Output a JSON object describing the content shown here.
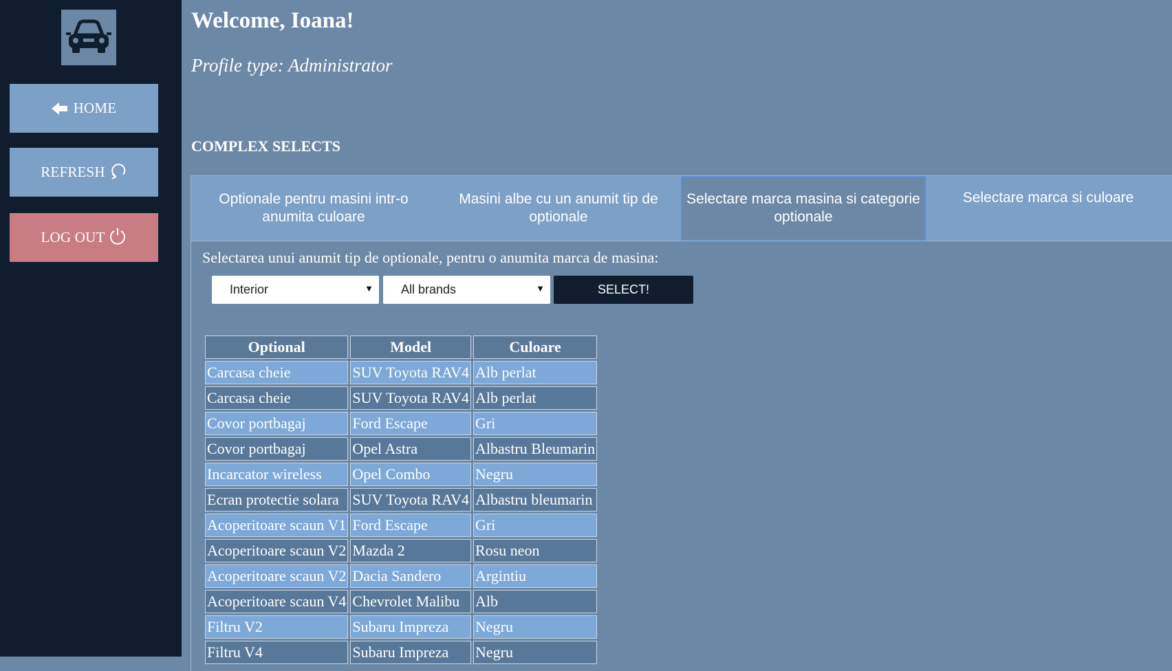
{
  "sidebar": {
    "logo_icon": "car-icon",
    "home_label": "HOME",
    "refresh_label": "REFRESH",
    "logout_label": "LOG OUT"
  },
  "header": {
    "welcome": "Welcome, Ioana!",
    "profile": "Profile type: Administrator"
  },
  "section_title": "COMPLEX SELECTS",
  "tabs": [
    {
      "label": "Optionale pentru masini intr-o anumita culoare",
      "active": false
    },
    {
      "label": "Masini albe cu un anumit tip de optionale",
      "active": false
    },
    {
      "label": "Selectare marca masina si categorie optionale",
      "active": true
    },
    {
      "label": "Selectare marca si culoare",
      "active": false
    }
  ],
  "query": {
    "label": "Selectarea unui anumit tip de optionale, pentru o anumita marca de masina:",
    "type_value": "Interior",
    "brand_value": "All brands",
    "button_label": "SELECT!"
  },
  "table": {
    "headers": [
      "Optional",
      "Model",
      "Culoare"
    ],
    "rows": [
      [
        "Carcasa cheie",
        "SUV Toyota RAV4",
        "Alb perlat"
      ],
      [
        "Carcasa cheie",
        "SUV Toyota RAV4",
        "Alb perlat"
      ],
      [
        "Covor portbagaj",
        "Ford Escape",
        "Gri"
      ],
      [
        "Covor portbagaj",
        "Opel Astra",
        "Albastru Bleumarin"
      ],
      [
        "Incarcator wireless",
        "Opel Combo",
        "Negru"
      ],
      [
        "Ecran protectie solara",
        "SUV Toyota RAV4",
        "Albastru bleumarin"
      ],
      [
        "Acoperitoare scaun V1",
        "Ford Escape",
        "Gri"
      ],
      [
        "Acoperitoare scaun V2",
        "Mazda 2",
        "Rosu neon"
      ],
      [
        "Acoperitoare scaun V2",
        "Dacia Sandero",
        "Argintiu"
      ],
      [
        "Acoperitoare scaun V4",
        "Chevrolet Malibu",
        "Alb"
      ],
      [
        "Filtru V2",
        "Subaru Impreza",
        "Negru"
      ],
      [
        "Filtru V4",
        "Subaru Impreza",
        "Negru"
      ]
    ]
  },
  "colors": {
    "sidebar_bg": "#0f1d2e",
    "main_bg": "#6b88a6",
    "button_blue": "#7da0c6",
    "logout_red": "#c97d82",
    "row_light": "#7da8d8",
    "row_dark": "#58789a"
  }
}
